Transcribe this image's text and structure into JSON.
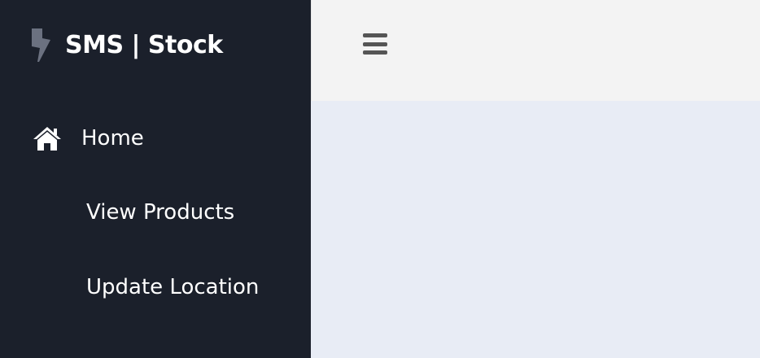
{
  "brand": {
    "title": "SMS | Stock",
    "icon": "bolt-icon"
  },
  "sidebar": {
    "items": [
      {
        "label": "Home",
        "icon": "home-icon"
      },
      {
        "label": "View Products"
      },
      {
        "label": "Update Location"
      }
    ]
  },
  "topbar": {
    "menu_icon": "hamburger-menu-icon"
  },
  "colors": {
    "sidebar_bg": "#1b202b",
    "topbar_bg": "#f3f3f3",
    "content_bg": "#e8ecf5",
    "brand_icon": "#6b7180",
    "menu_icon": "#555555",
    "text_light": "#ffffff"
  }
}
